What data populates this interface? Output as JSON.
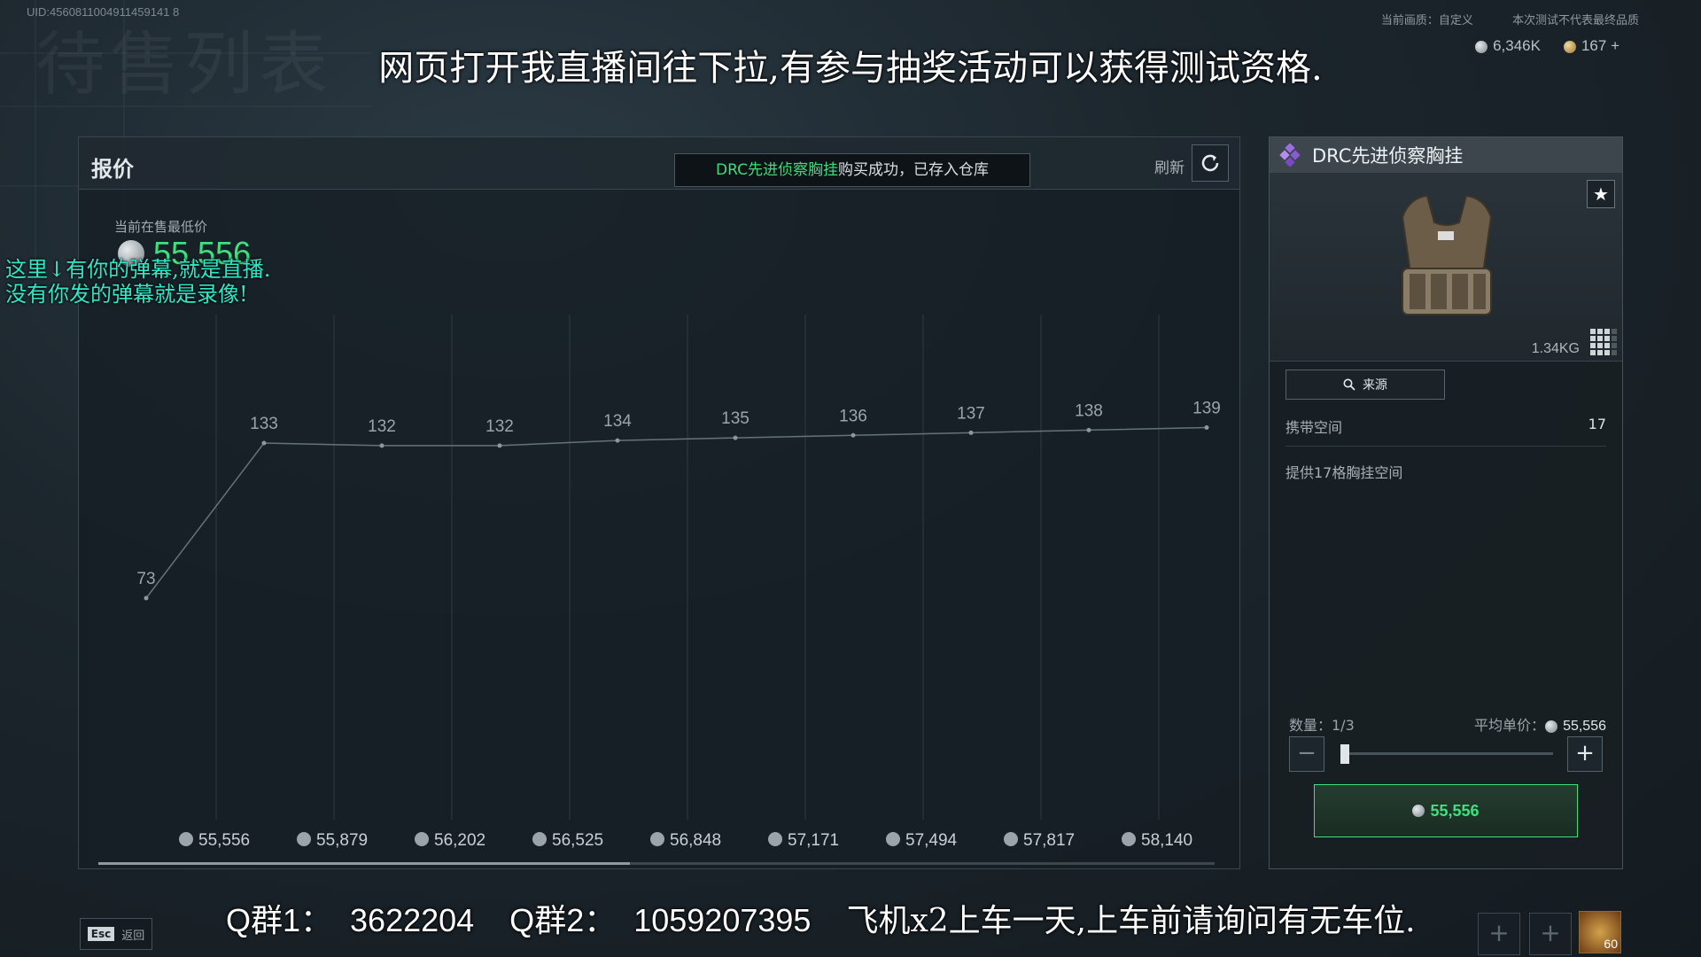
{
  "uid": "UID:4560811004911459141 8",
  "background_title": "待售列表",
  "overlay_top": "网页打开我直播间往下拉,有参与抽奖活动可以获得测试资格.",
  "top_right": {
    "quality": "当前画质：自定义",
    "notice": "本次测试不代表最终品质"
  },
  "currency": {
    "silver": "6,346K",
    "gold": "167",
    "gold_add": "+"
  },
  "panel": {
    "title": "报价",
    "toast_item": "DRC先进侦察胸挂",
    "toast_rest": "购买成功，已存入仓库",
    "refresh_label": "刷新",
    "lowest_label": "当前在售最低价",
    "lowest_value": "55,556"
  },
  "danmaku": {
    "line1": "这里↓有你的弹幕,就是直播.",
    "line2": "没有你发的弹幕就是录像!"
  },
  "chart_data": {
    "type": "line",
    "x": [
      "55,556",
      "55,879",
      "56,202",
      "56,525",
      "56,848",
      "57,171",
      "57,494",
      "57,817",
      "58,140"
    ],
    "values": [
      73,
      133,
      132,
      132,
      134,
      135,
      136,
      137,
      138,
      139
    ],
    "xlabel": "",
    "ylabel": "",
    "grid": true
  },
  "side": {
    "title": "DRC先进侦察胸挂",
    "weight": "1.34KG",
    "source_label": "来源",
    "stat_label": "携带空间",
    "stat_value": "17",
    "description": "提供17格胸挂空间",
    "qty_label": "数量：1/3",
    "avg_label": "平均单价：",
    "avg_value": "55,556",
    "qty_fraction": 0.0,
    "buy_value": "55,556",
    "fav_icon": "★",
    "accent": "#3fe07e"
  },
  "overlay_bottom": {
    "qq": "Q群1：  3622204    Q群2：  1059207395    ",
    "cn": "飞机x2上车一天,上车前请询问有无车位."
  },
  "esc": {
    "key": "Esc",
    "label": "返回"
  },
  "bottom_slots": {
    "plus": "+",
    "badge": "60"
  }
}
